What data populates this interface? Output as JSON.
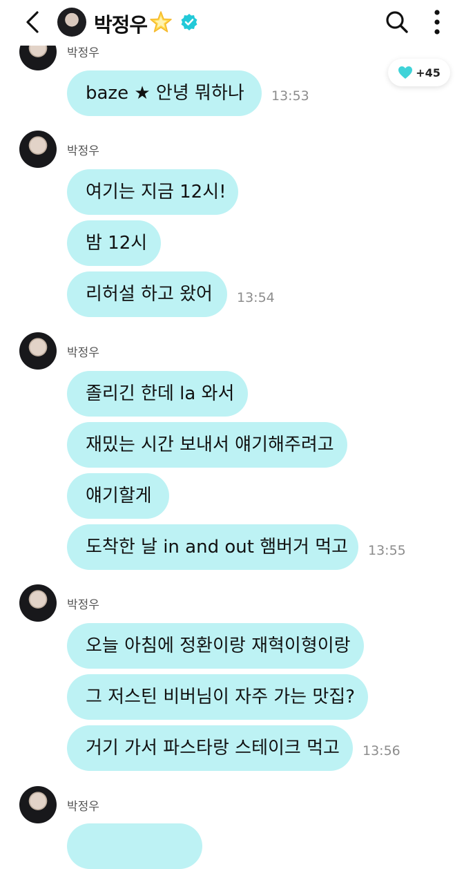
{
  "header": {
    "name": "박정우"
  },
  "reaction": {
    "count": "+45",
    "heart_color": "#3fd3d8"
  },
  "colors": {
    "bubble": "#bdf2f4",
    "verified": "#22c9d8"
  },
  "messages": [
    {
      "sender": "박정우",
      "texts": [
        "baze ★ 안녕 뭐하나"
      ],
      "time": "13:53"
    },
    {
      "sender": "박정우",
      "texts": [
        "여기는 지금 12시!",
        "밤 12시",
        "리허설 하고 왔어"
      ],
      "time": "13:54"
    },
    {
      "sender": "박정우",
      "texts": [
        "졸리긴 한데 la 와서",
        "재밌는 시간 보내서 얘기해주려고",
        "얘기할게",
        "도착한 날 in and out 햄버거 먹고"
      ],
      "time": "13:55"
    },
    {
      "sender": "박정우",
      "texts": [
        "오늘 아침에 정환이랑 재혁이형이랑",
        "그 저스틴 비버님이 자주 가는 맛집?",
        "거기 가서 파스타랑 스테이크 먹고"
      ],
      "time": "13:56"
    },
    {
      "sender": "박정우",
      "texts": [],
      "time": ""
    }
  ]
}
